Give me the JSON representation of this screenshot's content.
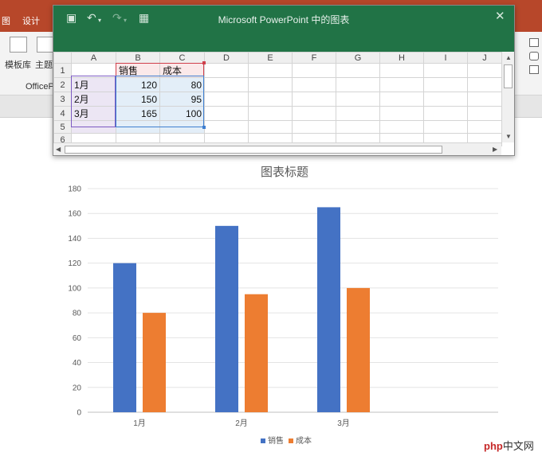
{
  "ppt": {
    "tabs": [
      "图",
      "设计"
    ],
    "ribbon_buttons": [
      "模板库",
      "主题"
    ],
    "ribbon_group": "OfficeP"
  },
  "editor": {
    "title": "Microsoft PowerPoint 中的图表",
    "columns": [
      "A",
      "B",
      "C",
      "D",
      "E",
      "F",
      "G",
      "H",
      "I",
      "J"
    ],
    "rows": [
      [
        "",
        "销售",
        "成本",
        "",
        "",
        "",
        "",
        "",
        "",
        ""
      ],
      [
        "1月",
        "120",
        "80",
        "",
        "",
        "",
        "",
        "",
        "",
        ""
      ],
      [
        "2月",
        "150",
        "95",
        "",
        "",
        "",
        "",
        "",
        "",
        ""
      ],
      [
        "3月",
        "165",
        "100",
        "",
        "",
        "",
        "",
        "",
        "",
        ""
      ],
      [
        "",
        "",
        "",
        "",
        "",
        "",
        "",
        "",
        "",
        ""
      ],
      [
        "",
        "",
        "",
        "",
        "",
        "",
        "",
        "",
        "",
        ""
      ]
    ],
    "row_numbers": [
      "1",
      "2",
      "3",
      "4",
      "5",
      "6"
    ]
  },
  "colors": {
    "series1": "#4472c4",
    "series2": "#ed7d31",
    "excel_green": "#217346",
    "ppt_red": "#b7472a",
    "annotation_arrow": "#e53935"
  },
  "chart_data": {
    "type": "bar",
    "title": "图表标题",
    "categories": [
      "1月",
      "2月",
      "3月"
    ],
    "series": [
      {
        "name": "销售",
        "values": [
          120,
          150,
          165
        ]
      },
      {
        "name": "成本",
        "values": [
          80,
          95,
          100
        ]
      }
    ],
    "ylim": [
      0,
      180
    ],
    "yticks": [
      0,
      20,
      40,
      60,
      80,
      100,
      120,
      140,
      160,
      180
    ],
    "grid": true,
    "legend": "bottom"
  },
  "watermark": {
    "brand": "php",
    "site": "中文网"
  }
}
